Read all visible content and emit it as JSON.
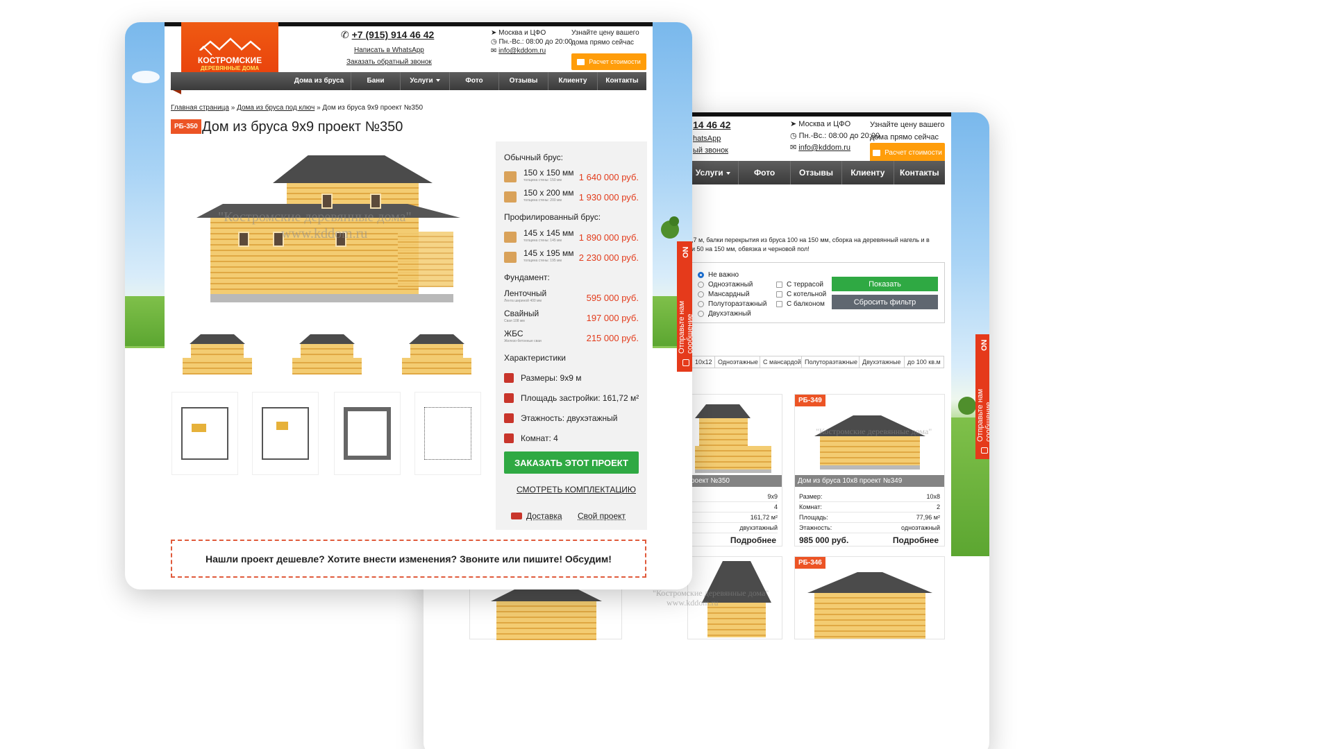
{
  "brand": {
    "line1": "КОСТРОМСКИЕ",
    "line2": "ДЕРЕВЯННЫЕ ДОМА"
  },
  "header": {
    "phone": "+7 (915) 914 46 42",
    "phone_partial": "14 46 42",
    "whatsapp": "Написать в WhatsApp",
    "whatsapp_partial": "hatsApp",
    "callback": "Заказать обратный звонок",
    "callback_partial": "ый звонок",
    "region": "Москва и ЦФО",
    "hours": "Пн.-Вс.: 08:00 до 20:00",
    "email": "info@kddom.ru",
    "hint_line1": "Узнайте цену вашего",
    "hint_line2": "дома прямо сейчас",
    "calc_button": "Расчет стоимости"
  },
  "nav": {
    "items": [
      "Дома из бруса",
      "Бани",
      "Услуги",
      "Фото",
      "Отзывы",
      "Клиенту",
      "Контакты"
    ],
    "back_items": [
      "Услуги",
      "Фото",
      "Отзывы",
      "Клиенту",
      "Контакты"
    ]
  },
  "side_tab": "Отправьте нам сообщение",
  "side_tab_short": "Отправь",
  "breadcrumb": {
    "home": "Главная страница",
    "sep": "»",
    "section": "Дома из бруса под ключ",
    "current": "Дом из бруса 9х9 проект №350"
  },
  "product": {
    "code": "РБ-350",
    "title": "Дом из бруса 9х9 проект №350",
    "watermark1": "\"Костромские деревянные дома\"",
    "watermark2": "www.kddom.ru",
    "ordinary_title": "Обычный брус:",
    "ordinary": [
      {
        "size": "150 х 150 мм",
        "note": "толщина стены: 150 мм",
        "price": "1 640 000 руб."
      },
      {
        "size": "150 х 200 мм",
        "note": "толщина стены: 200 мм",
        "price": "1 930 000 руб."
      }
    ],
    "profiled_title": "Профилированный брус:",
    "profiled": [
      {
        "size": "145 х 145 мм",
        "note": "толщина стены: 145 мм",
        "price": "1 890 000 руб."
      },
      {
        "size": "145 х 195 мм",
        "note": "толщина стены: 195 мм",
        "price": "2 230 000 руб."
      }
    ],
    "foundation_title": "Фундамент:",
    "foundation": [
      {
        "size": "Ленточный",
        "note": "Лента шириной 400 мм",
        "price": "595 000 руб."
      },
      {
        "size": "Свайный",
        "note": "Свая 108 мм",
        "price": "197 000 руб."
      },
      {
        "size": "ЖБС",
        "note": "Железо-бетонные сваи",
        "price": "215 000 руб."
      }
    ],
    "chars_title": "Характеристики",
    "chars": [
      {
        "label": "Размеры: 9х9 м"
      },
      {
        "label": "Площадь застройки: 161,72 м²"
      },
      {
        "label": "Этажность: двухэтажный"
      },
      {
        "label": "Комнат: 4"
      }
    ],
    "order_button": "ЗАКАЗАТЬ ЭТОТ ПРОЕКТ",
    "config_link": "СМОТРЕТЬ КОМПЛЕКТАЦИЮ",
    "delivery": "Доставка",
    "own_project": "Свой проект",
    "cta": "Нашли проект дешевле? Хотите внести изменения? Звоните или пишите! Обсудим!"
  },
  "back": {
    "desc_line1": ",7 м, балки перекрытия из бруса 100 на 150 мм, сборка на деревянный нагель и в",
    "desc_line2": "и 50 на 150 мм, обвязка и черновой пол!",
    "radios": [
      "Не важно",
      "Одноэтажный",
      "Мансардный",
      "Полутораэтажный",
      "Двухэтажный"
    ],
    "checks": [
      "С террасой",
      "С котельной",
      "С балконом"
    ],
    "show_button": "Показать",
    "reset_button": "Сбросить фильтр",
    "tags": [
      "10х12",
      "Одноэтажные",
      "С мансардой",
      "Полутораэтажные",
      "Двухэтажные",
      "до 100 кв.м"
    ],
    "card1": {
      "caption": "роект №350",
      "rows": [
        {
          "k": "",
          "v": "9х9"
        },
        {
          "k": "",
          "v": "4"
        },
        {
          "k": "",
          "v": "161,72 м²"
        },
        {
          "k": "",
          "v": "двухэтажный"
        }
      ],
      "more": "Подробнее"
    },
    "card2": {
      "code": "РБ-349",
      "caption": "Дом из бруса 10х8 проект №349",
      "rows": [
        {
          "k": "Размер:",
          "v": "10х8"
        },
        {
          "k": "Комнат:",
          "v": "2"
        },
        {
          "k": "Площадь:",
          "v": "77,96 м²"
        },
        {
          "k": "Этажность:",
          "v": "одноэтажный"
        }
      ],
      "price": "985 000 руб.",
      "more": "Подробнее"
    },
    "card3": {
      "code": "РБ-346"
    }
  }
}
